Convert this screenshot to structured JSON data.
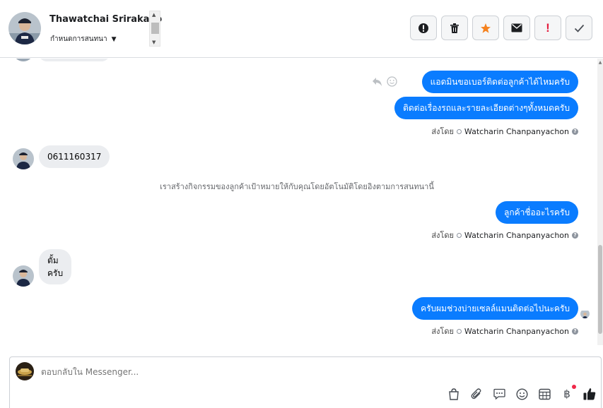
{
  "header": {
    "name": "Thawatchai Srirakaeo",
    "status": "กำหนดการสนทนา"
  },
  "actions": [
    {
      "icon": "alert-circle-icon"
    },
    {
      "icon": "trash-icon"
    },
    {
      "icon": "star-icon",
      "color": "#f5821f"
    },
    {
      "icon": "envelope-icon"
    },
    {
      "icon": "exclamation-icon",
      "color": "#e41e3f"
    },
    {
      "icon": "check-icon"
    }
  ],
  "messages": {
    "out1": "แอดมินขอเบอร์ติดต่อลูกค้าได้ไหมครับ",
    "out2": "ติดต่อเรื่องรถและรายละเอียดต่างๆทั้งหมดครับ",
    "sent1_prefix": "ส่งโดย",
    "sent1_name": "Watcharin Chanpanyachon",
    "in1": "0611160317",
    "system": "เราสร้างกิจกรรมของลูกค้าเป้าหมายให้กับคุณโดยอัตโนมัติโดยอิงตามการสนทนานี้",
    "out3": "ลูกค้าชื่ออะไรครับ",
    "sent2_prefix": "ส่งโดย",
    "sent2_name": "Watcharin Chanpanyachon",
    "in2_line1": "ตั้ม",
    "in2_line2": "ครับ",
    "out4": "ครับผมช่วงบ่ายเซลล์แมนติดต่อไปนะครับ",
    "sent3_prefix": "ส่งโดย",
    "sent3_name": "Watcharin Chanpanyachon"
  },
  "composer": {
    "placeholder": "ตอบกลับใน Messenger..."
  },
  "colors": {
    "accent": "#0a7cff",
    "incoming": "#ebedf0"
  }
}
